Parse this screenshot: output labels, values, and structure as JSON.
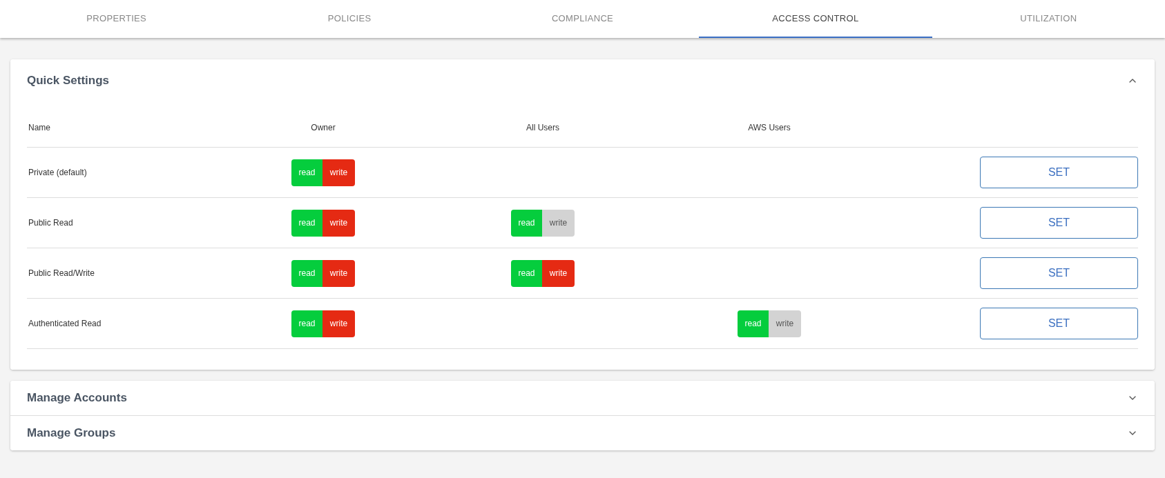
{
  "tabs": [
    {
      "label": "PROPERTIES",
      "selected": false
    },
    {
      "label": "POLICIES",
      "selected": false
    },
    {
      "label": "COMPLIANCE",
      "selected": false
    },
    {
      "label": "ACCESS CONTROL",
      "selected": true
    },
    {
      "label": "UTILIZATION",
      "selected": false
    }
  ],
  "sections": [
    {
      "title": "Quick Settings",
      "expanded": true,
      "table": {
        "columns": [
          "Name",
          "Owner",
          "All Users",
          "AWS Users"
        ],
        "rows": [
          {
            "name": "Private (default)",
            "owner": {
              "read_label": "read",
              "write_label": "write",
              "read": true,
              "write": true
            },
            "button": "SET"
          },
          {
            "name": "Public Read",
            "owner": {
              "read_label": "read",
              "write_label": "write",
              "read": true,
              "write": true
            },
            "all_users": {
              "read_label": "read",
              "write_label": "write",
              "read": true,
              "write": false
            },
            "button": "SET"
          },
          {
            "name": "Public Read/Write",
            "owner": {
              "read_label": "read",
              "write_label": "write",
              "read": true,
              "write": true
            },
            "all_users": {
              "read_label": "read",
              "write_label": "write",
              "read": true,
              "write": true
            },
            "button": "SET"
          },
          {
            "name": "Authenticated Read",
            "owner": {
              "read_label": "read",
              "write_label": "write",
              "read": true,
              "write": true
            },
            "aws_users": {
              "read_label": "read",
              "write_label": "write",
              "read": true,
              "write": false
            },
            "button": "SET"
          }
        ]
      }
    },
    {
      "title": "Manage Accounts",
      "expanded": false
    },
    {
      "title": "Manage Groups",
      "expanded": false
    }
  ]
}
